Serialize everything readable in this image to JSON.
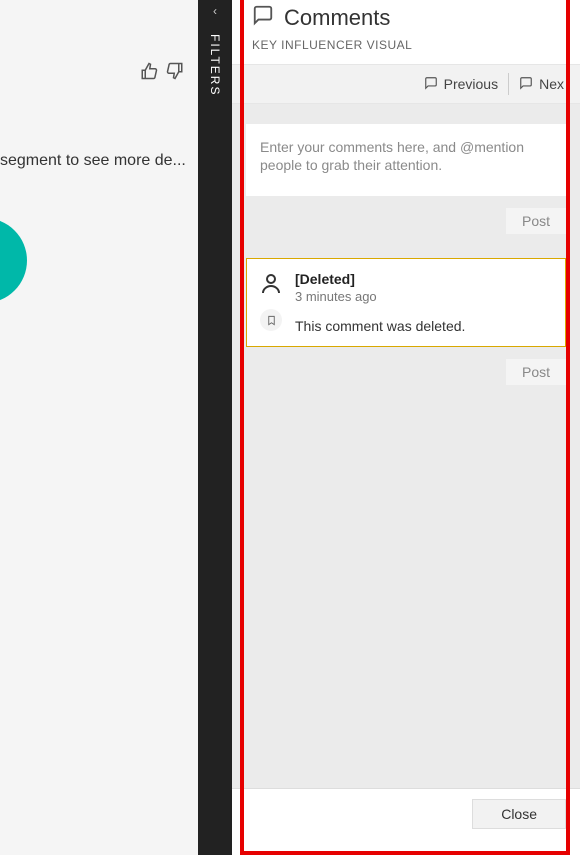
{
  "left": {
    "segment_text": "segment to see more de...",
    "circle_value": "",
    "teal_snippet": ""
  },
  "filters": {
    "label": "FILTERS"
  },
  "panel": {
    "title": "Comments",
    "subtitle": "KEY INFLUENCER VISUAL",
    "nav": {
      "previous": "Previous",
      "next": "Nex"
    },
    "input_placeholder": "Enter your comments here, and @mention people to grab their attention.",
    "post_label": "Post",
    "deleted": {
      "author": "[Deleted]",
      "time": "3 minutes ago",
      "message": "This comment was deleted."
    },
    "close_label": "Close"
  }
}
